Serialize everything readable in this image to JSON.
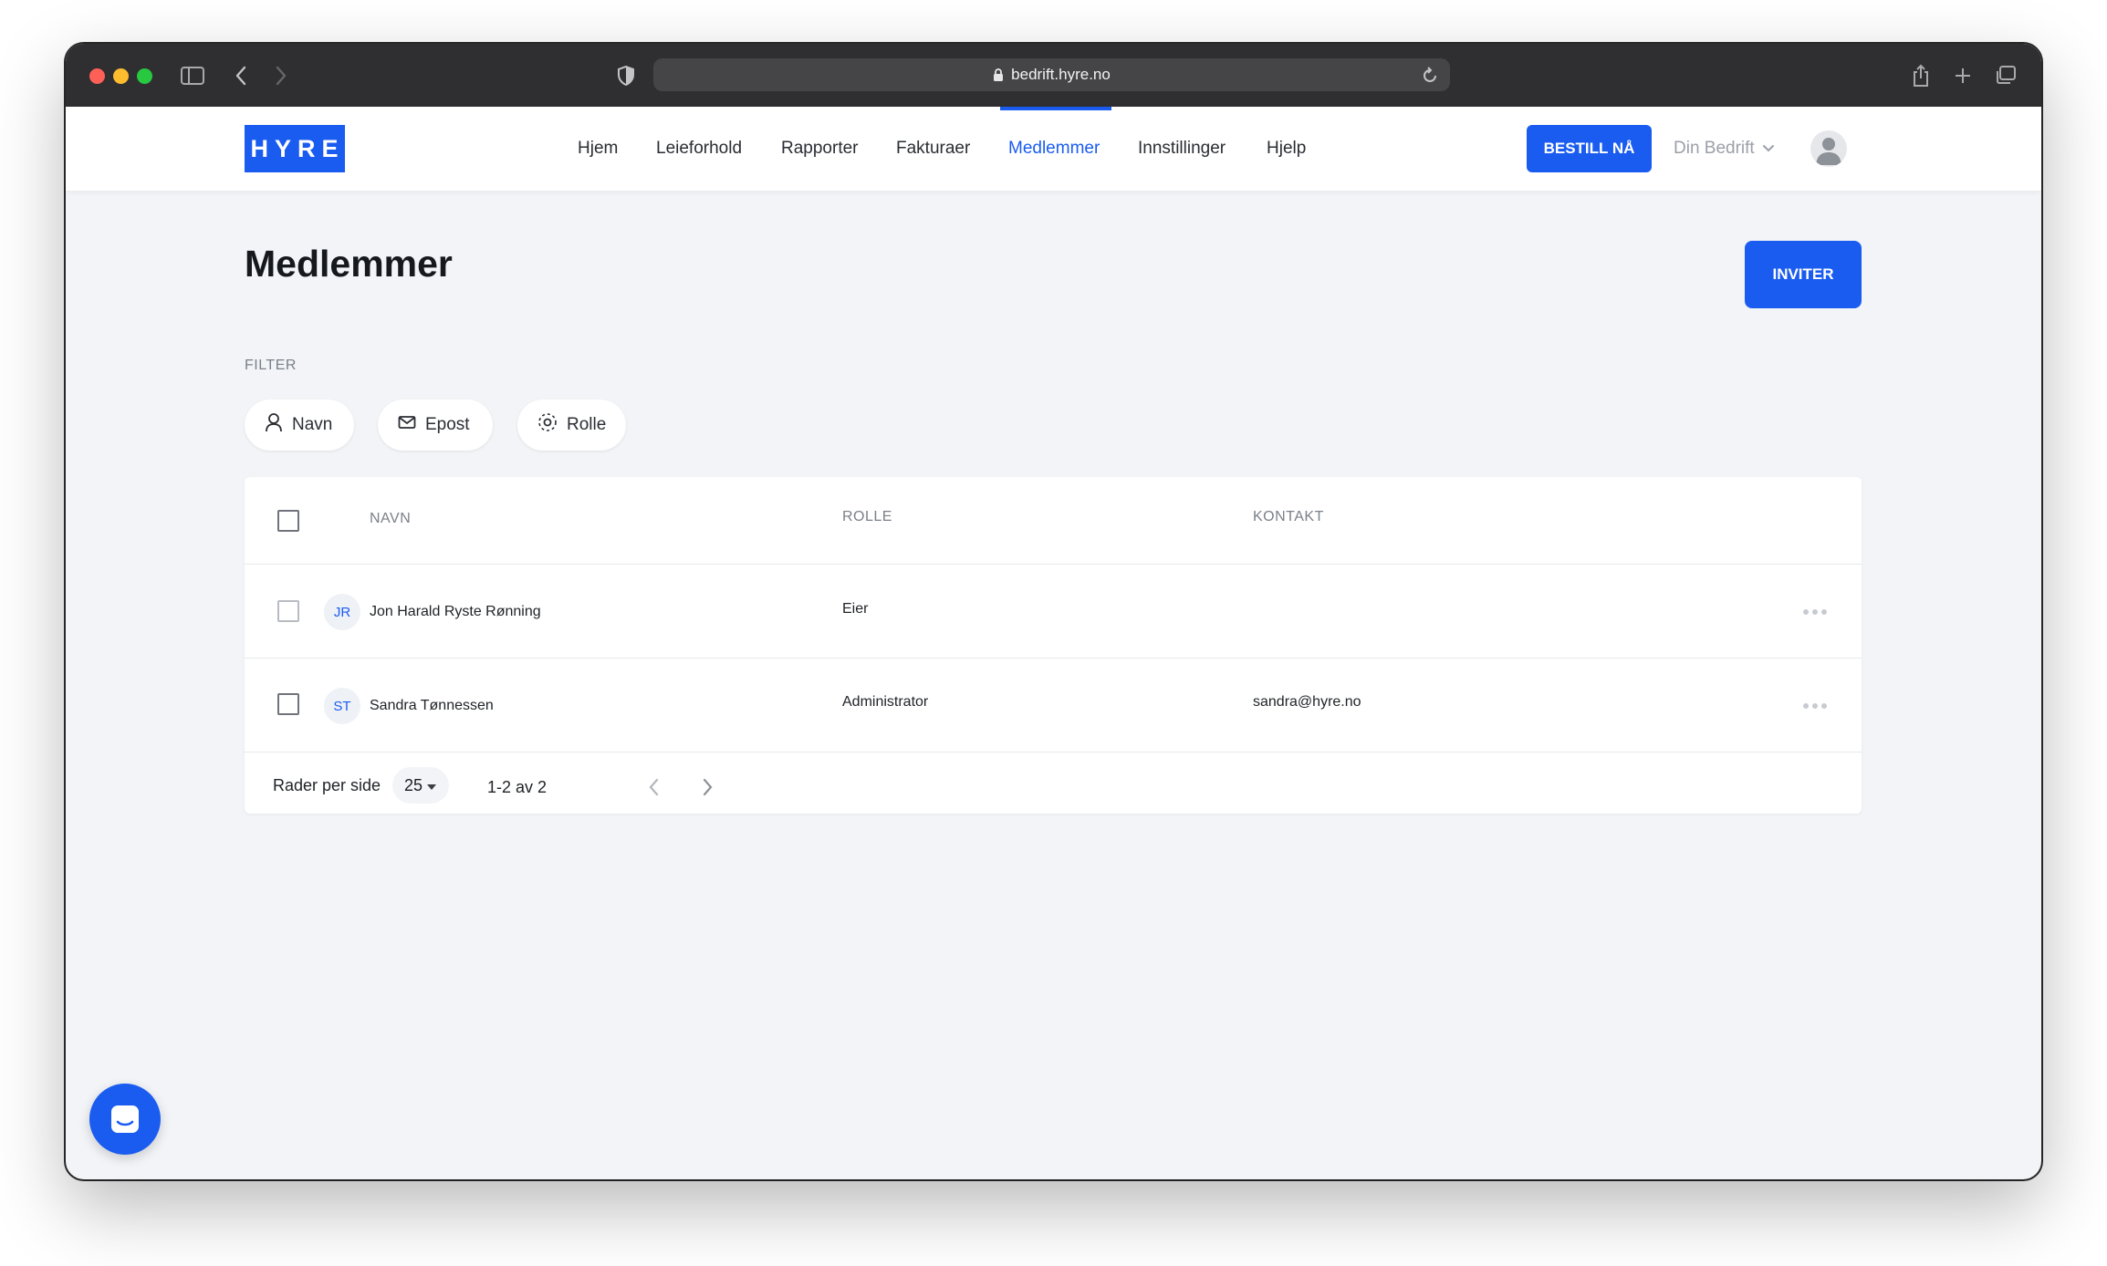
{
  "browser": {
    "url": "bedrift.hyre.no"
  },
  "header": {
    "logo": "HYRE",
    "nav": [
      {
        "label": "Hjem"
      },
      {
        "label": "Leieforhold"
      },
      {
        "label": "Rapporter"
      },
      {
        "label": "Fakturaer"
      },
      {
        "label": "Medlemmer",
        "active": true
      },
      {
        "label": "Innstillinger"
      },
      {
        "label": "Hjelp"
      }
    ],
    "order_button": "BESTILL NÅ",
    "company": "Din Bedrift"
  },
  "main": {
    "title": "Medlemmer",
    "invite_button": "INVITER",
    "filter_label": "FILTER",
    "filters": [
      {
        "label": "Navn",
        "icon": "person-icon"
      },
      {
        "label": "Epost",
        "icon": "envelope-icon"
      },
      {
        "label": "Rolle",
        "icon": "role-icon"
      }
    ]
  },
  "table": {
    "columns": [
      "NAVN",
      "ROLLE",
      "KONTAKT"
    ],
    "rows": [
      {
        "initials": "JR",
        "name": "Jon Harald Ryste Rønning",
        "role": "Eier",
        "contact": ""
      },
      {
        "initials": "ST",
        "name": "Sandra Tønnessen",
        "role": "Administrator",
        "contact": "sandra@hyre.no"
      }
    ],
    "footer": {
      "rows_per_page_label": "Rader per side",
      "rows_per_page": "25",
      "range": "1-2 av 2"
    }
  },
  "colors": {
    "accent": "#1a5cf0",
    "background": "#f2f4f7"
  }
}
